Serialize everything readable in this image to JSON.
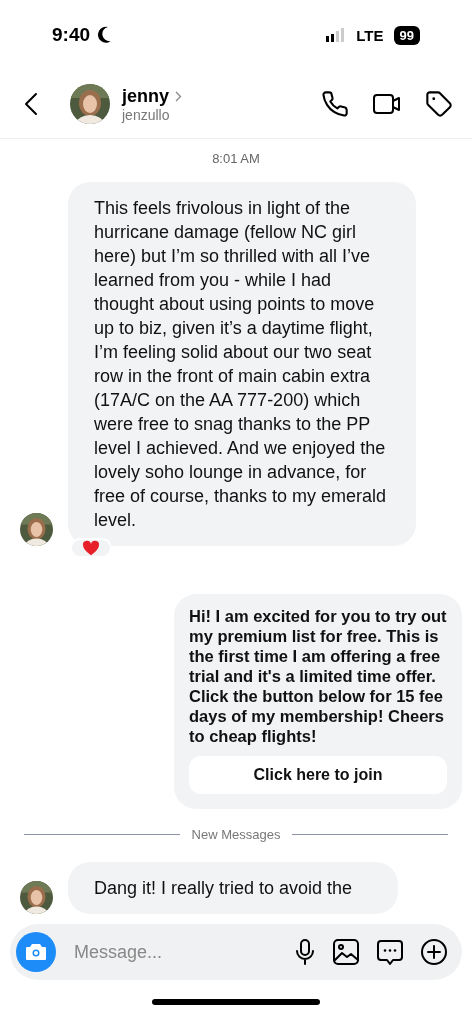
{
  "status_bar": {
    "time": "9:40",
    "focus_mode": true,
    "network": "LTE",
    "battery": "99"
  },
  "header": {
    "name": "jenny",
    "username": "jenzullo"
  },
  "timestamp": "8:01 AM",
  "messages": [
    {
      "kind": "incoming",
      "text": "This feels frivolous in light of the hurricane damage (fellow NC girl here) but I’m so thrilled with all I’ve learned from you - while I had thought about using points to move up to biz, given it’s a daytime flight, I’m feeling solid about our two seat row in the front of main cabin extra (17A/C on the AA 777-200) which were free to snag thanks to the PP level I achieved. And we enjoyed the lovely soho lounge in advance, for free of course, thanks to my emerald level.",
      "reacted": true
    },
    {
      "kind": "outgoing",
      "text": "Hi! I am excited for you to try out my premium list for free. This is the first time I am offering a free trial and it's a limited time offer. Click the button below for 15 fee days of my membership! Cheers to cheap flights!",
      "button": "Click here to join"
    },
    {
      "kind": "divider",
      "text": "New Messages"
    },
    {
      "kind": "incoming",
      "text": "Dang it! I really tried to avoid the"
    }
  ],
  "composer": {
    "placeholder": "Message..."
  }
}
